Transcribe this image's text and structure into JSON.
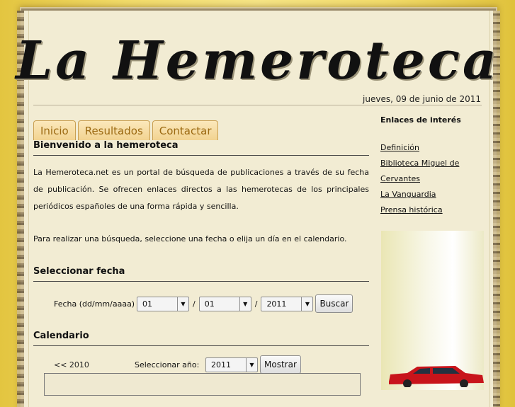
{
  "site": {
    "title": "La Hemeroteca",
    "date": "jueves, 09 de junio de 2011"
  },
  "tabs": [
    {
      "label": "Inicio"
    },
    {
      "label": "Resultados"
    },
    {
      "label": "Contactar"
    }
  ],
  "main": {
    "heading": "Bienvenido a la hemeroteca",
    "para1": "La Hemeroteca.net es un portal de búsqueda de publicaciones a través de su fecha de publicación. Se ofrecen enlaces directos a las hemerotecas de los principales periódicos españoles de una forma rápida y sencilla.",
    "para2": "Para realizar una búsqueda, seleccione una fecha o elija un día en el calendario."
  },
  "date_form": {
    "heading": "Seleccionar fecha",
    "label": "Fecha (dd/mm/aaaa)",
    "day": "01",
    "month": "01",
    "year": "2011",
    "separator": "/",
    "button": "Buscar"
  },
  "calendar": {
    "heading": "Calendario",
    "prev_link": "<< 2010",
    "year_label": "Seleccionar año:",
    "year": "2011",
    "button": "Mostrar"
  },
  "sidebar": {
    "heading": "Enlaces de interés",
    "links": [
      {
        "label": "Definición"
      },
      {
        "label": "Biblioteca Miguel de Cervantes"
      },
      {
        "label": "La Vanguardia"
      },
      {
        "label": "Prensa histórica"
      }
    ]
  },
  "icons": {
    "dropdown": "chevron-down-icon"
  },
  "colors": {
    "tab_text": "#9c6a12",
    "paper": "#f2ecd3",
    "background": "#e8cd4f"
  }
}
